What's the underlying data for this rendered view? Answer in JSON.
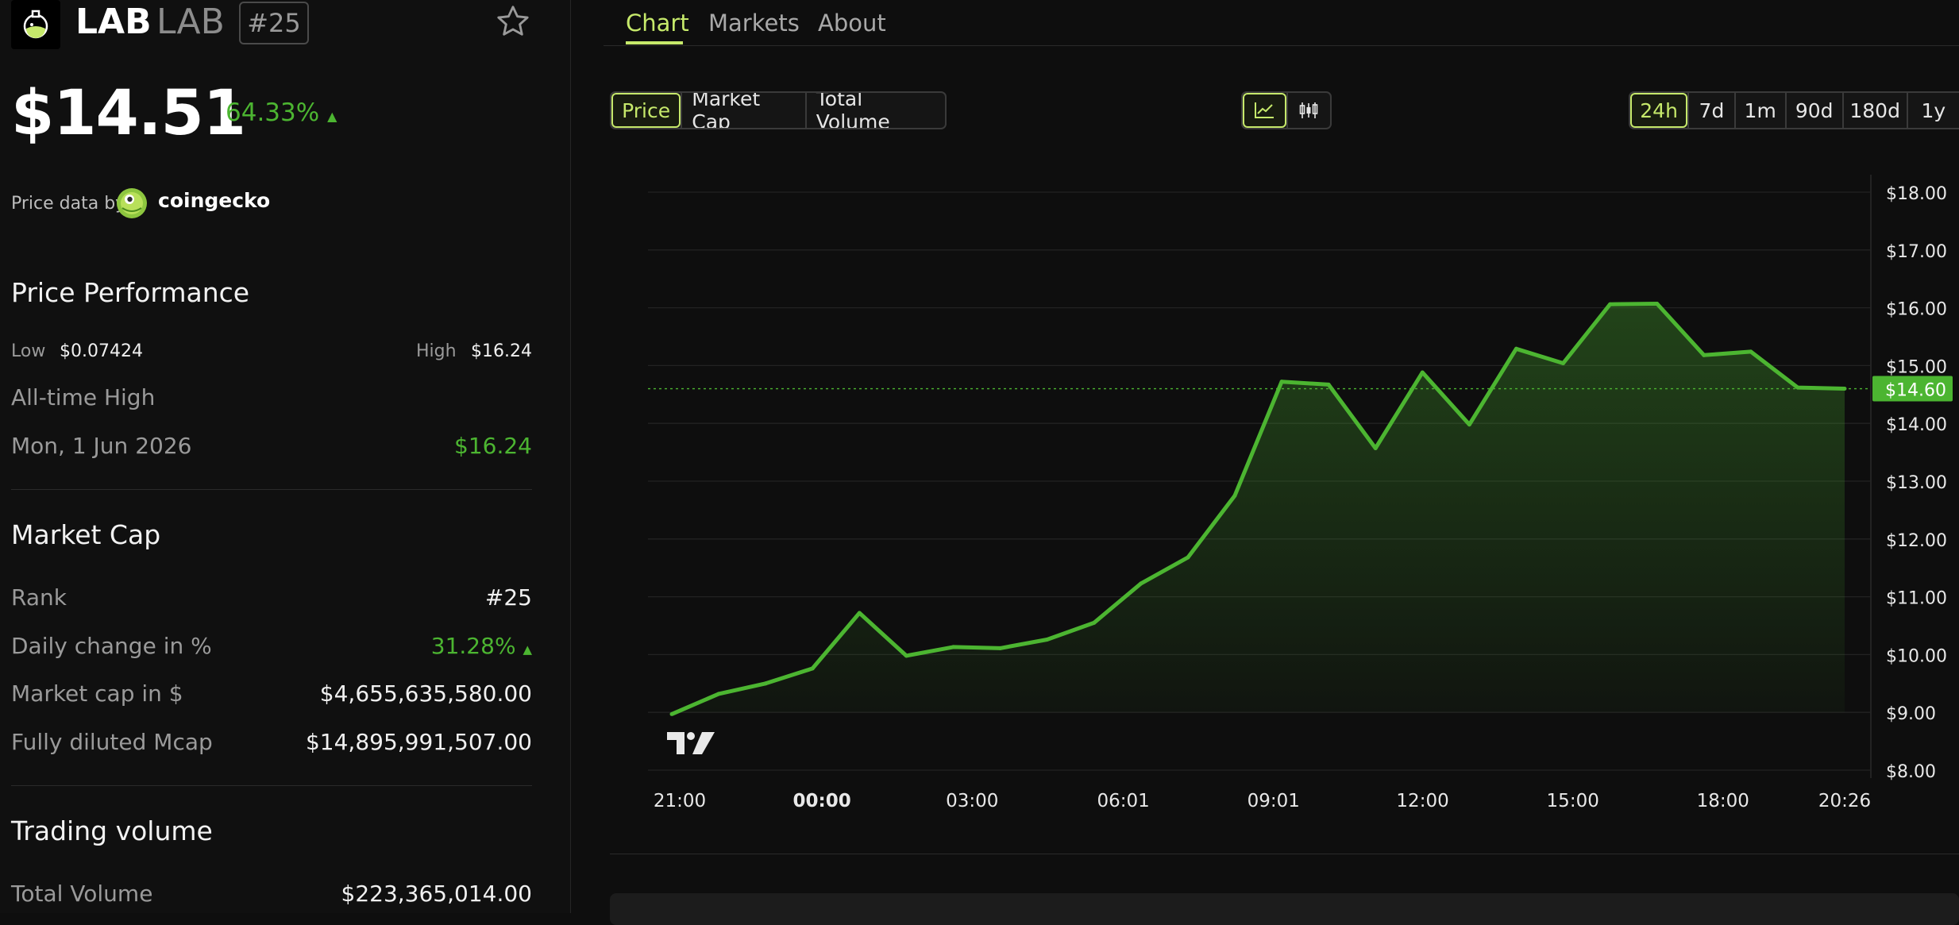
{
  "coin": {
    "symbol": "LAB",
    "name": "LAB",
    "rank_badge": "#25",
    "price": "$14.51",
    "change_24h": "64.33%",
    "change_arrow": "▲",
    "price_data_by": "Price data by",
    "provider": "coingecko"
  },
  "performance": {
    "title": "Price Performance",
    "low_label": "Low",
    "low_value": "$0.07424",
    "high_label": "High",
    "high_value": "$16.24",
    "ath_label": "All-time High",
    "ath_date": "Mon, 1 Jun 2026",
    "ath_value": "$16.24"
  },
  "market_cap": {
    "title": "Market Cap",
    "rows": [
      {
        "label": "Rank",
        "value": "#25"
      },
      {
        "label": "Daily change in %",
        "value": "31.28%",
        "arrow": "▲"
      },
      {
        "label": "Market cap in $",
        "value": "$4,655,635,580.00"
      },
      {
        "label": "Fully diluted Mcap",
        "value": "$14,895,991,507.00"
      }
    ]
  },
  "trading_volume": {
    "title": "Trading volume",
    "rows": [
      {
        "label": "Total Volume",
        "value": "$223,365,014.00"
      }
    ]
  },
  "tabs": [
    "Chart",
    "Markets",
    "About"
  ],
  "metric_buttons": [
    "Price",
    "Market Cap",
    "Total Volume"
  ],
  "chart_type_buttons": [
    "line-chart-icon",
    "candlestick-icon"
  ],
  "range_buttons": [
    "24h",
    "7d",
    "1m",
    "90d",
    "180d",
    "1y"
  ],
  "selected": {
    "tab": "Chart",
    "metric": "Price",
    "range": "24h",
    "chart_type": "line-chart-icon"
  },
  "colors": {
    "accent": "#c6e96b",
    "line": "#4cb531",
    "up": "#4cb531",
    "background": "#0e0e0e"
  },
  "chart_data": {
    "type": "area",
    "ylim": [
      8,
      18
    ],
    "y_ticks": [
      "$18.00",
      "$17.00",
      "$16.00",
      "$15.00",
      "$14.00",
      "$13.00",
      "$12.00",
      "$11.00",
      "$10.00",
      "$9.00",
      "$8.00"
    ],
    "y_tick_values": [
      18,
      17,
      16,
      15,
      14,
      13,
      12,
      11,
      10,
      9,
      8
    ],
    "x_ticks": [
      "21:00",
      "00:00",
      "03:00",
      "06:01",
      "09:01",
      "12:00",
      "15:00",
      "18:00",
      "20:26"
    ],
    "x_tick_hours": [
      0,
      3,
      6,
      9.02,
      12.02,
      15,
      18,
      21,
      23.43
    ],
    "x_tick_bold": [
      false,
      true,
      false,
      false,
      false,
      false,
      false,
      false,
      false
    ],
    "last_price_label": "$14.60",
    "last_price": 14.6,
    "series": [
      {
        "x": [
          0,
          1,
          2,
          3,
          4,
          5,
          6,
          7,
          8,
          9,
          10,
          11,
          12,
          13,
          14,
          15,
          16,
          17,
          18,
          19,
          20,
          21,
          22,
          23,
          24,
          25
        ],
        "values": [
          8.97,
          9.32,
          9.5,
          9.76,
          10.72,
          9.98,
          10.13,
          10.11,
          10.26,
          10.55,
          11.23,
          11.68,
          12.75,
          14.72,
          14.67,
          13.57,
          14.88,
          13.98,
          15.29,
          15.04,
          16.06,
          16.07,
          15.18,
          15.24,
          14.62,
          14.6
        ]
      }
    ]
  }
}
